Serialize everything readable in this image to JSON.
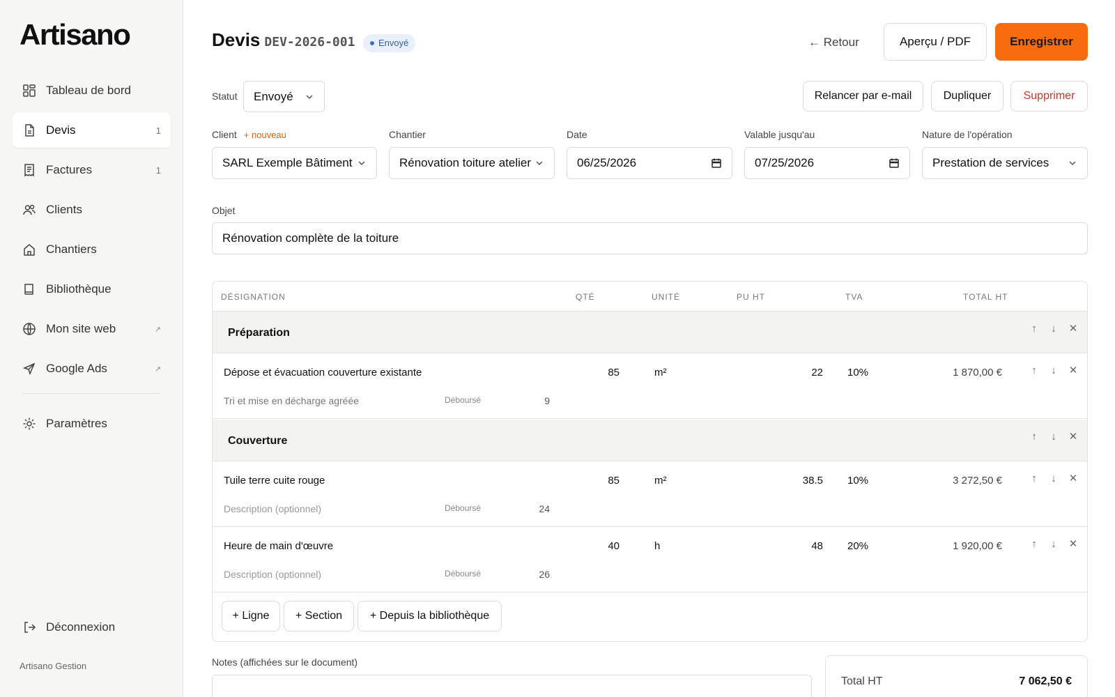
{
  "app": {
    "logo": "Artisano",
    "footer": "Artisano Gestion"
  },
  "sidebar": {
    "items": [
      {
        "label": "Tableau de bord",
        "icon": "dashboard-icon",
        "count": ""
      },
      {
        "label": "Devis",
        "icon": "document-icon",
        "count": "1"
      },
      {
        "label": "Factures",
        "icon": "invoice-icon",
        "count": "1"
      },
      {
        "label": "Clients",
        "icon": "users-icon",
        "count": ""
      },
      {
        "label": "Chantiers",
        "icon": "building-icon",
        "count": ""
      },
      {
        "label": "Bibliothèque",
        "icon": "book-icon",
        "count": ""
      },
      {
        "label": "Mon site web",
        "icon": "globe-icon",
        "count": "↗"
      },
      {
        "label": "Google Ads",
        "icon": "send-icon",
        "count": "↗"
      },
      {
        "label": "Paramètres",
        "icon": "gear-icon",
        "count": ""
      }
    ],
    "logout": "Déconnexion"
  },
  "header": {
    "title": "Devis",
    "doc_number": "DEV-2026-001",
    "status_badge": "Envoyé",
    "back": "← Retour",
    "preview": "Aperçu / PDF",
    "save": "Enregistrer"
  },
  "toolbar": {
    "status_label": "Statut",
    "status_value": "Envoyé",
    "remind": "Relancer par e-mail",
    "duplicate": "Dupliquer",
    "delete": "Supprimer"
  },
  "form": {
    "client_label": "Client",
    "client_new": "+ nouveau",
    "client_value": "SARL Exemple Bâtiment",
    "site_label": "Chantier",
    "site_value": "Rénovation toiture atelier",
    "date_label": "Date",
    "date_value": "06/25/2026",
    "valid_label": "Valable jusqu'au",
    "valid_value": "07/25/2026",
    "nature_label": "Nature de l'opération",
    "nature_value": "Prestation de services",
    "object_label": "Objet",
    "object_value": "Rénovation complète de la toiture"
  },
  "table": {
    "headers": {
      "designation": "DÉSIGNATION",
      "qty": "QTÉ",
      "unit": "UNITÉ",
      "pu": "PU HT",
      "tva": "TVA",
      "total": "TOTAL HT"
    },
    "deb_label": "Déboursé",
    "sections": [
      {
        "title": "Préparation"
      },
      {
        "title": "Couverture"
      }
    ],
    "lines": [
      {
        "designation": "Dépose et évacuation couverture existante",
        "description": "Tri et mise en décharge agréée",
        "debourse": "9",
        "qty": "85",
        "unit": "m²",
        "pu": "22",
        "tva": "10%",
        "total": "1 870,00 €"
      },
      {
        "designation": "Tuile terre cuite rouge",
        "description": "Description (optionnel)",
        "debourse": "24",
        "qty": "85",
        "unit": "m²",
        "pu": "38.5",
        "tva": "10%",
        "total": "3 272,50 €"
      },
      {
        "designation": "Heure de main d'œuvre",
        "description": "Description (optionnel)",
        "debourse": "26",
        "qty": "40",
        "unit": "h",
        "pu": "48",
        "tva": "20%",
        "total": "1 920,00 €"
      }
    ],
    "add_line": "+ Ligne",
    "add_section": "+ Section",
    "add_library": "+ Depuis la bibliothèque"
  },
  "notes": {
    "label": "Notes (affichées sur le document)"
  },
  "totals": {
    "ht_label": "Total HT",
    "ht_value": "7 062,50 €"
  },
  "colors": {
    "accent": "#f76c0e",
    "status_blue": "#2f5fb3",
    "danger": "#c0392b"
  }
}
